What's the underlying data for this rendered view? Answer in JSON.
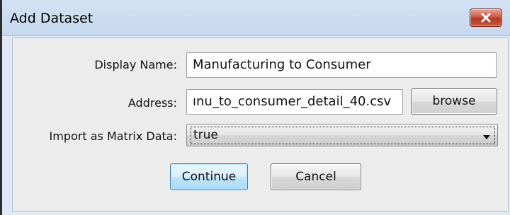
{
  "window": {
    "title": "Add Dataset"
  },
  "form": {
    "display_name_label": "Display Name:",
    "display_name_value": "Manufacturing to Consumer",
    "address_label": "Address:",
    "address_value": "ınu_to_consumer_detail_40.csv",
    "browse_label": "browse",
    "matrix_label": "Import as Matrix Data:",
    "matrix_value": "true"
  },
  "buttons": {
    "continue_label": "Continue",
    "cancel_label": "Cancel"
  },
  "icons": {
    "close": "close-icon",
    "dropdown": "chevron-down-icon"
  },
  "colors": {
    "titlebar": "#c9daef",
    "close_button": "#c94a33",
    "default_button": "#bee6fd",
    "panel": "#ececec"
  }
}
